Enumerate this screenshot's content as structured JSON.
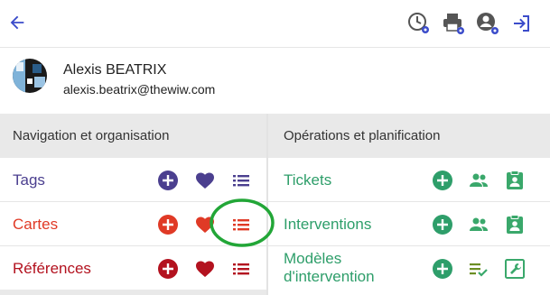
{
  "user": {
    "name": "Alexis BEATRIX",
    "email": "alexis.beatrix@thewiw.com"
  },
  "left_panel": {
    "title": "Navigation et organisation",
    "rows": [
      {
        "label": "Tags",
        "color": "#4b3f8f"
      },
      {
        "label": "Cartes",
        "color": "#e03a26"
      },
      {
        "label": "Références",
        "color": "#b3121f"
      }
    ]
  },
  "right_panel": {
    "title": "Opérations et planification",
    "rows": [
      {
        "label": "Tickets"
      },
      {
        "label": "Interventions"
      },
      {
        "label_line1": "Modèles",
        "label_line2": "d'intervention"
      }
    ],
    "color": "#2e9e6a",
    "icon_color": "#3aa86b"
  },
  "colors": {
    "accent_blue": "#3b4cca",
    "grey_icon": "#555555",
    "header_bg": "#e9e9e9",
    "annotation_green": "#22a637"
  },
  "icons": {
    "toolbar": [
      "back-arrow-icon",
      "clock-settings-icon",
      "printer-settings-icon",
      "user-settings-icon",
      "logout-icon"
    ],
    "left": [
      "add-icon",
      "heart-icon",
      "list-icon"
    ],
    "right": [
      "add-icon",
      "people-icon",
      "clipboard-person-icon",
      "checklist-icon",
      "wrench-icon"
    ]
  }
}
